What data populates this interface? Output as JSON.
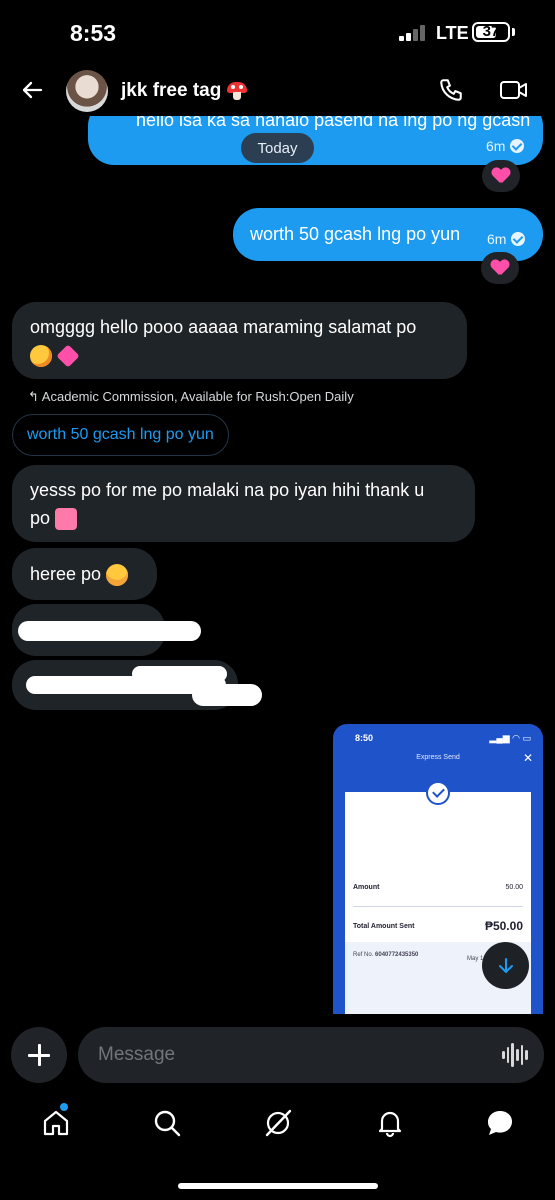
{
  "status_bar": {
    "time": "8:53",
    "network": "LTE",
    "battery": "37"
  },
  "header": {
    "name": "jkk free tag",
    "name_emoji_icon": "mushroom-icon"
  },
  "messages": {
    "out_1": {
      "text": "hello isa ka sa nanalo pasend na lng po ng gcash",
      "time": "6m"
    },
    "today_label": "Today",
    "out_2": {
      "text": "worth 50 gcash lng po yun",
      "time": "6m"
    },
    "in_1": {
      "line1": "omgggg hello pooo aaaaa maraming salamat po"
    },
    "reply_reference": "Academic Commission, Available for Rush:Open Daily",
    "quoted_text": "worth 50 gcash lng po yun",
    "in_2": {
      "line1": "yesss po for me po malaki na po iyan hihi thank u",
      "line2": "po"
    },
    "in_3": {
      "text": "heree po"
    }
  },
  "attachment": {
    "status_time": "8:50",
    "title": "Express Send",
    "amount_label": "Amount",
    "amount_value": "50.00",
    "total_label": "Total Amount Sent",
    "total_value": "₱50.00",
    "ref_label": "Ref No.",
    "ref_value": "6040772435350",
    "date_partial": "May 1"
  },
  "composer": {
    "placeholder": "Message"
  },
  "nav": [
    "home-icon",
    "search-icon",
    "grok-icon",
    "notifications-icon",
    "messages-icon"
  ],
  "colors": {
    "accent": "#1d9bf0",
    "bubble_in": "#1f2428",
    "background": "#000000"
  }
}
